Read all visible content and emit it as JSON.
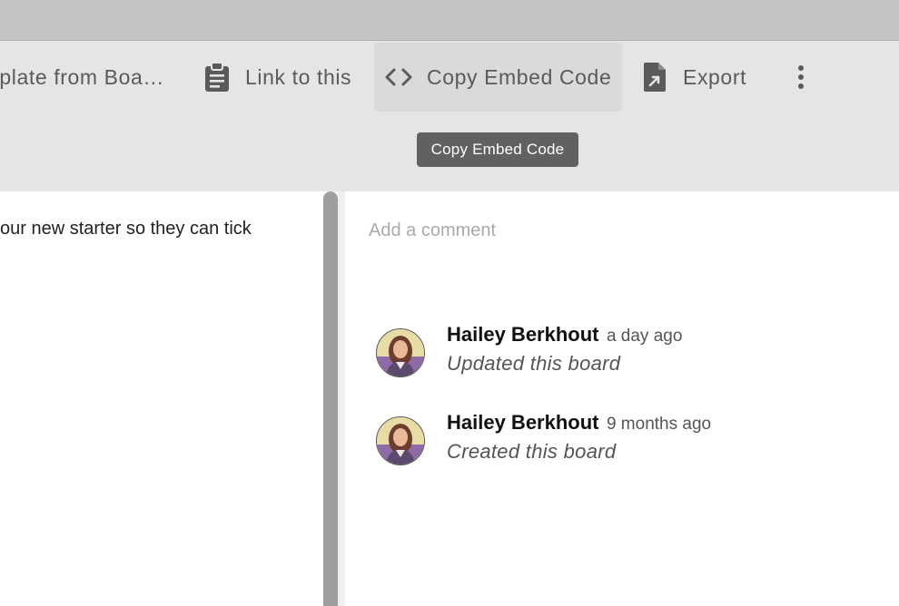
{
  "toolbar": {
    "items": [
      {
        "label": "nplate from Boa…",
        "icon": "template-icon"
      },
      {
        "label": "Link to this",
        "icon": "clipboard-icon"
      },
      {
        "label": "Copy Embed Code",
        "icon": "code-icon"
      },
      {
        "label": "Export",
        "icon": "file-export-icon"
      }
    ],
    "more_icon": "more-vert-icon",
    "tooltip": "Copy Embed Code"
  },
  "board": {
    "description_fragment": "our new starter so they can tick"
  },
  "comments": {
    "placeholder": "Add a comment",
    "activity": [
      {
        "user": "Hailey Berkhout",
        "time": "a day ago",
        "action": "Updated this board"
      },
      {
        "user": "Hailey Berkhout",
        "time": "9 months ago",
        "action": "Created this board"
      }
    ]
  },
  "colors": {
    "toolbar_bg": "#e5e5e5",
    "top_strip": "#c4c4c4",
    "tooltip_bg": "#616161",
    "scrollbar": "#9e9e9e"
  }
}
